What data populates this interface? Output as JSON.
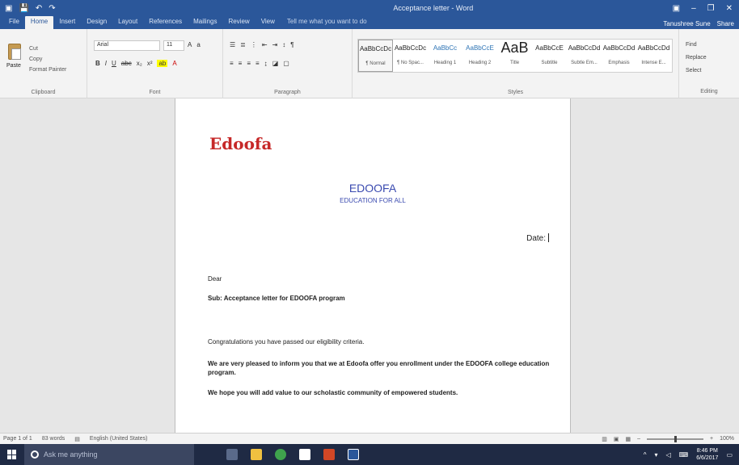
{
  "window": {
    "title": "Acceptance letter - Word",
    "controls": [
      "▣",
      "–",
      "❐",
      "✕"
    ]
  },
  "qat": [
    "💾",
    "↶",
    "↷",
    "📋"
  ],
  "tabs": [
    "File",
    "Home",
    "Insert",
    "Design",
    "Layout",
    "References",
    "Mailings",
    "Review",
    "View"
  ],
  "tell_me": "Tell me what you want to do",
  "account": "Tanushree Sune",
  "share": "Share",
  "ribbon": {
    "clipboard": {
      "paste": "Paste",
      "cut": "Cut",
      "copy": "Copy",
      "format_painter": "Format Painter",
      "label": "Clipboard"
    },
    "font": {
      "face": "Arial",
      "size": "11",
      "label": "Font"
    },
    "paragraph": {
      "label": "Paragraph"
    },
    "styles": {
      "label": "Styles",
      "items": [
        {
          "preview": "AaBbCcDc",
          "name": "¶ Normal"
        },
        {
          "preview": "AaBbCcDc",
          "name": "¶ No Spac..."
        },
        {
          "preview": "AaBbCc",
          "name": "Heading 1"
        },
        {
          "preview": "AaBbCcE",
          "name": "Heading 2"
        },
        {
          "preview": "AaB",
          "name": "Title"
        },
        {
          "preview": "AaBbCcE",
          "name": "Subtitle"
        },
        {
          "preview": "AaBbCcDd",
          "name": "Subtle Em..."
        },
        {
          "preview": "AaBbCcDd",
          "name": "Emphasis"
        },
        {
          "preview": "AaBbCcDd",
          "name": "Intense E..."
        }
      ]
    },
    "editing": {
      "find": "Find",
      "replace": "Replace",
      "select": "Select",
      "label": "Editing"
    }
  },
  "document": {
    "brand": "Edoofa",
    "org_name": "EDOOFA",
    "tagline": "EDUCATION FOR ALL",
    "date_label": "Date:",
    "salutation": "Dear",
    "subject": "Sub: Acceptance letter for EDOOFA program",
    "para1": "Congratulations you have passed our eligibility criteria.",
    "para2": "We are very pleased to inform you that we at Edoofa offer you enrollment under the EDOOFA college education program.",
    "para3": "We hope you will add value to our scholastic community of empowered students."
  },
  "status": {
    "page": "Page 1 of 1",
    "words": "83 words",
    "language": "English (United States)",
    "zoom_percent": "100%"
  },
  "taskbar": {
    "search_placeholder": "Ask me anything",
    "time": "8:46 PM",
    "date": "6/6/2017"
  },
  "colors": {
    "word_blue": "#2b579a",
    "brand_red": "#c62828",
    "org_blue": "#3b4bb0"
  }
}
